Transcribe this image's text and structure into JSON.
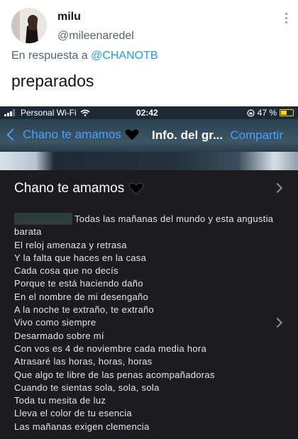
{
  "tweet": {
    "display_name": "milu",
    "handle": "@mileenaredel",
    "reply_prefix": "En respuesta a",
    "reply_mention": "@CHANOTB",
    "text": "preparados"
  },
  "status_bar": {
    "carrier": "Personal Wi-Fi",
    "time": "02:42",
    "battery_percent": "47 %",
    "battery_level": 0.47
  },
  "nav": {
    "back_label": "Chano te amamos",
    "title": "Info. del gr...",
    "share_label": "Compartir"
  },
  "group": {
    "name": "Chano te amamos"
  },
  "description": {
    "lines": [
      "Todas las mañanas del mundo y esta angustia",
      "barata",
      "El reloj amenaza y retrasa",
      "Y la falta que haces en la casa",
      "Cada cosa que no decís",
      "Porque te está haciendo daño",
      "En el nombre de mi desengaño",
      "A la noche te extraño, te extraño",
      "Vivo como siempre",
      "Desarmado sobre mí",
      "Con vos es 4 de noviembre cada media hora",
      "Atrasaré las horas, horas, horas",
      "Que algo te libre de las penas acompañadoras",
      "Cuando te sientas sola, sola, sola",
      "Toda tu mesita de luz",
      "Lleva el color de tu esencia",
      "Las mañanas exigen clemencia"
    ]
  },
  "colors": {
    "accent": "#1d9bf0",
    "ios_blue": "#4aa0ff",
    "dark_bg": "#1c1c1e",
    "battery": "#ffd60a"
  },
  "icons": [
    "more-vertical-icon",
    "signal-icon",
    "wifi-icon",
    "orientation-lock-icon",
    "battery-icon",
    "chevron-left-icon",
    "black-heart-icon",
    "chevron-right-icon"
  ]
}
